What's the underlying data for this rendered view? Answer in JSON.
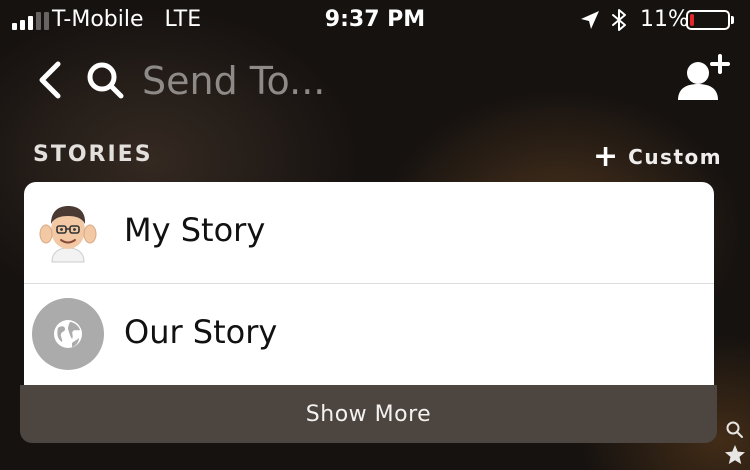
{
  "status_bar": {
    "carrier": "T-Mobile",
    "network": "LTE",
    "time": "9:37 PM",
    "battery_percent": "11%",
    "battery_level": 0.11,
    "signal_bars_filled": 3,
    "signal_bars_total": 5
  },
  "header": {
    "search_placeholder": "Send To...",
    "back_icon": "chevron-left-icon",
    "search_icon": "search-icon",
    "add_friend_icon": "add-friend-icon"
  },
  "stories_section": {
    "title": "STORIES",
    "custom_button": "Custom",
    "items": [
      {
        "label": "My Story",
        "icon": "bitmoji-avatar"
      },
      {
        "label": "Our Story",
        "icon": "globe-icon"
      }
    ],
    "show_more": "Show More"
  },
  "colors": {
    "battery_low": "#e8242c",
    "card_background": "#ffffff",
    "show_more_background": "#4d4640",
    "placeholder_text": "#8d8a88"
  }
}
